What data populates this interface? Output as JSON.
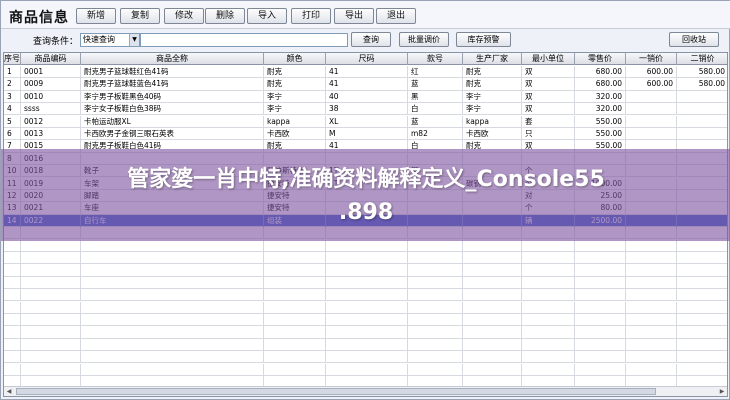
{
  "app": {
    "title": "商品信息"
  },
  "toolbar": {
    "buttons": [
      "新增",
      "复制",
      "修改",
      "删除",
      "导入",
      "打印",
      "导出",
      "退出"
    ]
  },
  "search": {
    "label": "查询条件：",
    "mode_value": "快速查询",
    "query_value": "",
    "buttons": [
      "查询",
      "批量调价",
      "库存预警"
    ],
    "recycle_label": "回收站"
  },
  "grid": {
    "columns": [
      "序号",
      "商品编码",
      "商品全称",
      "颜色",
      "尺码",
      "款号",
      "生产厂家",
      "最小单位",
      "零售价",
      "一销价",
      "二销价"
    ],
    "rows": [
      [
        "1",
        "0001",
        "耐克男子篮球鞋红色41码",
        "耐克",
        "41",
        "红",
        "耐克",
        "双",
        "680.00",
        "600.00",
        "580.00"
      ],
      [
        "2",
        "0009",
        "耐克男子篮球鞋蓝色41码",
        "耐克",
        "41",
        "蓝",
        "耐克",
        "双",
        "680.00",
        "600.00",
        "580.00"
      ],
      [
        "3",
        "0010",
        "李宁男子板鞋黑色40码",
        "李宁",
        "40",
        "黑",
        "李宁",
        "双",
        "320.00",
        "",
        ""
      ],
      [
        "4",
        "ssss",
        "李宁女子板鞋白色38码",
        "李宁",
        "38",
        "白",
        "李宁",
        "双",
        "320.00",
        "",
        ""
      ],
      [
        "5",
        "0012",
        "卡帕运动服XL",
        "kappa",
        "XL",
        "蓝",
        "kappa",
        "套",
        "550.00",
        "",
        ""
      ],
      [
        "6",
        "0013",
        "卡西欧男子金钢三眼石英表",
        "卡西欧",
        "M",
        "m82",
        "卡西欧",
        "只",
        "550.00",
        "",
        ""
      ],
      [
        "7",
        "0015",
        "耐克男子板鞋白色41码",
        "耐克",
        "41",
        "白",
        "耐克",
        "双",
        "550.00",
        "",
        ""
      ],
      [
        "8",
        "0016",
        "",
        "",
        "",
        "",
        "",
        "",
        "",
        "",
        ""
      ],
      [
        "10",
        "0018",
        "靴子",
        "阿迪斯特朗",
        "1T",
        "钢",
        "",
        "个",
        "",
        "",
        ""
      ],
      [
        "11",
        "0019",
        "车架",
        "捷安特",
        "1T",
        "",
        "碳钢",
        "个",
        "1000.00",
        "",
        ""
      ],
      [
        "12",
        "0020",
        "脚踏",
        "捷安特",
        "",
        "",
        "",
        "对",
        "25.00",
        "",
        ""
      ],
      [
        "13",
        "0021",
        "车座",
        "捷安特",
        "",
        "",
        "",
        "个",
        "80.00",
        "",
        ""
      ],
      [
        "14",
        "0022",
        "自行车",
        "组装",
        "",
        "",
        "",
        "辆",
        "2500.00",
        "",
        ""
      ]
    ],
    "selected_row": 12
  },
  "watermark": {
    "line1": "管家婆一肖中特,准确资料解释定义_Console55",
    "line2": ".898"
  }
}
